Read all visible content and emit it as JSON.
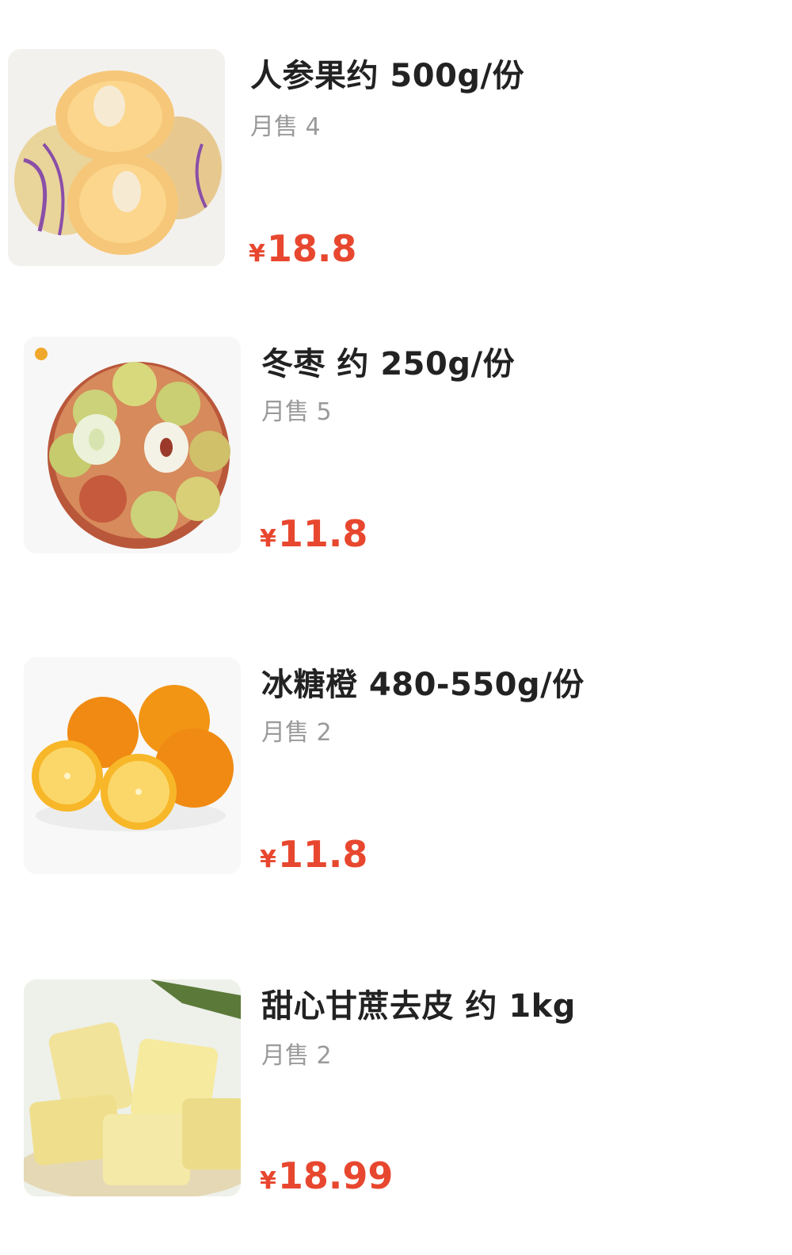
{
  "products": [
    {
      "name": "人参果约 500g/份",
      "sales": "月售 4",
      "currency": "¥",
      "price": "18.8",
      "image_icon": "pepino-melon-image"
    },
    {
      "name": "冬枣 约 250g/份",
      "sales": "月售 5",
      "currency": "¥",
      "price": "11.8",
      "image_icon": "winter-jujube-image"
    },
    {
      "name": "冰糖橙 480-550g/份",
      "sales": "月售 2",
      "currency": "¥",
      "price": "11.8",
      "image_icon": "orange-image"
    },
    {
      "name": "甜心甘蔗去皮 约 1kg",
      "sales": "月售 2",
      "currency": "¥",
      "price": "18.99",
      "image_icon": "peeled-sugarcane-image"
    }
  ],
  "colors": {
    "price": "#e8472f",
    "title": "#222222",
    "sales": "#9a9a9a"
  }
}
